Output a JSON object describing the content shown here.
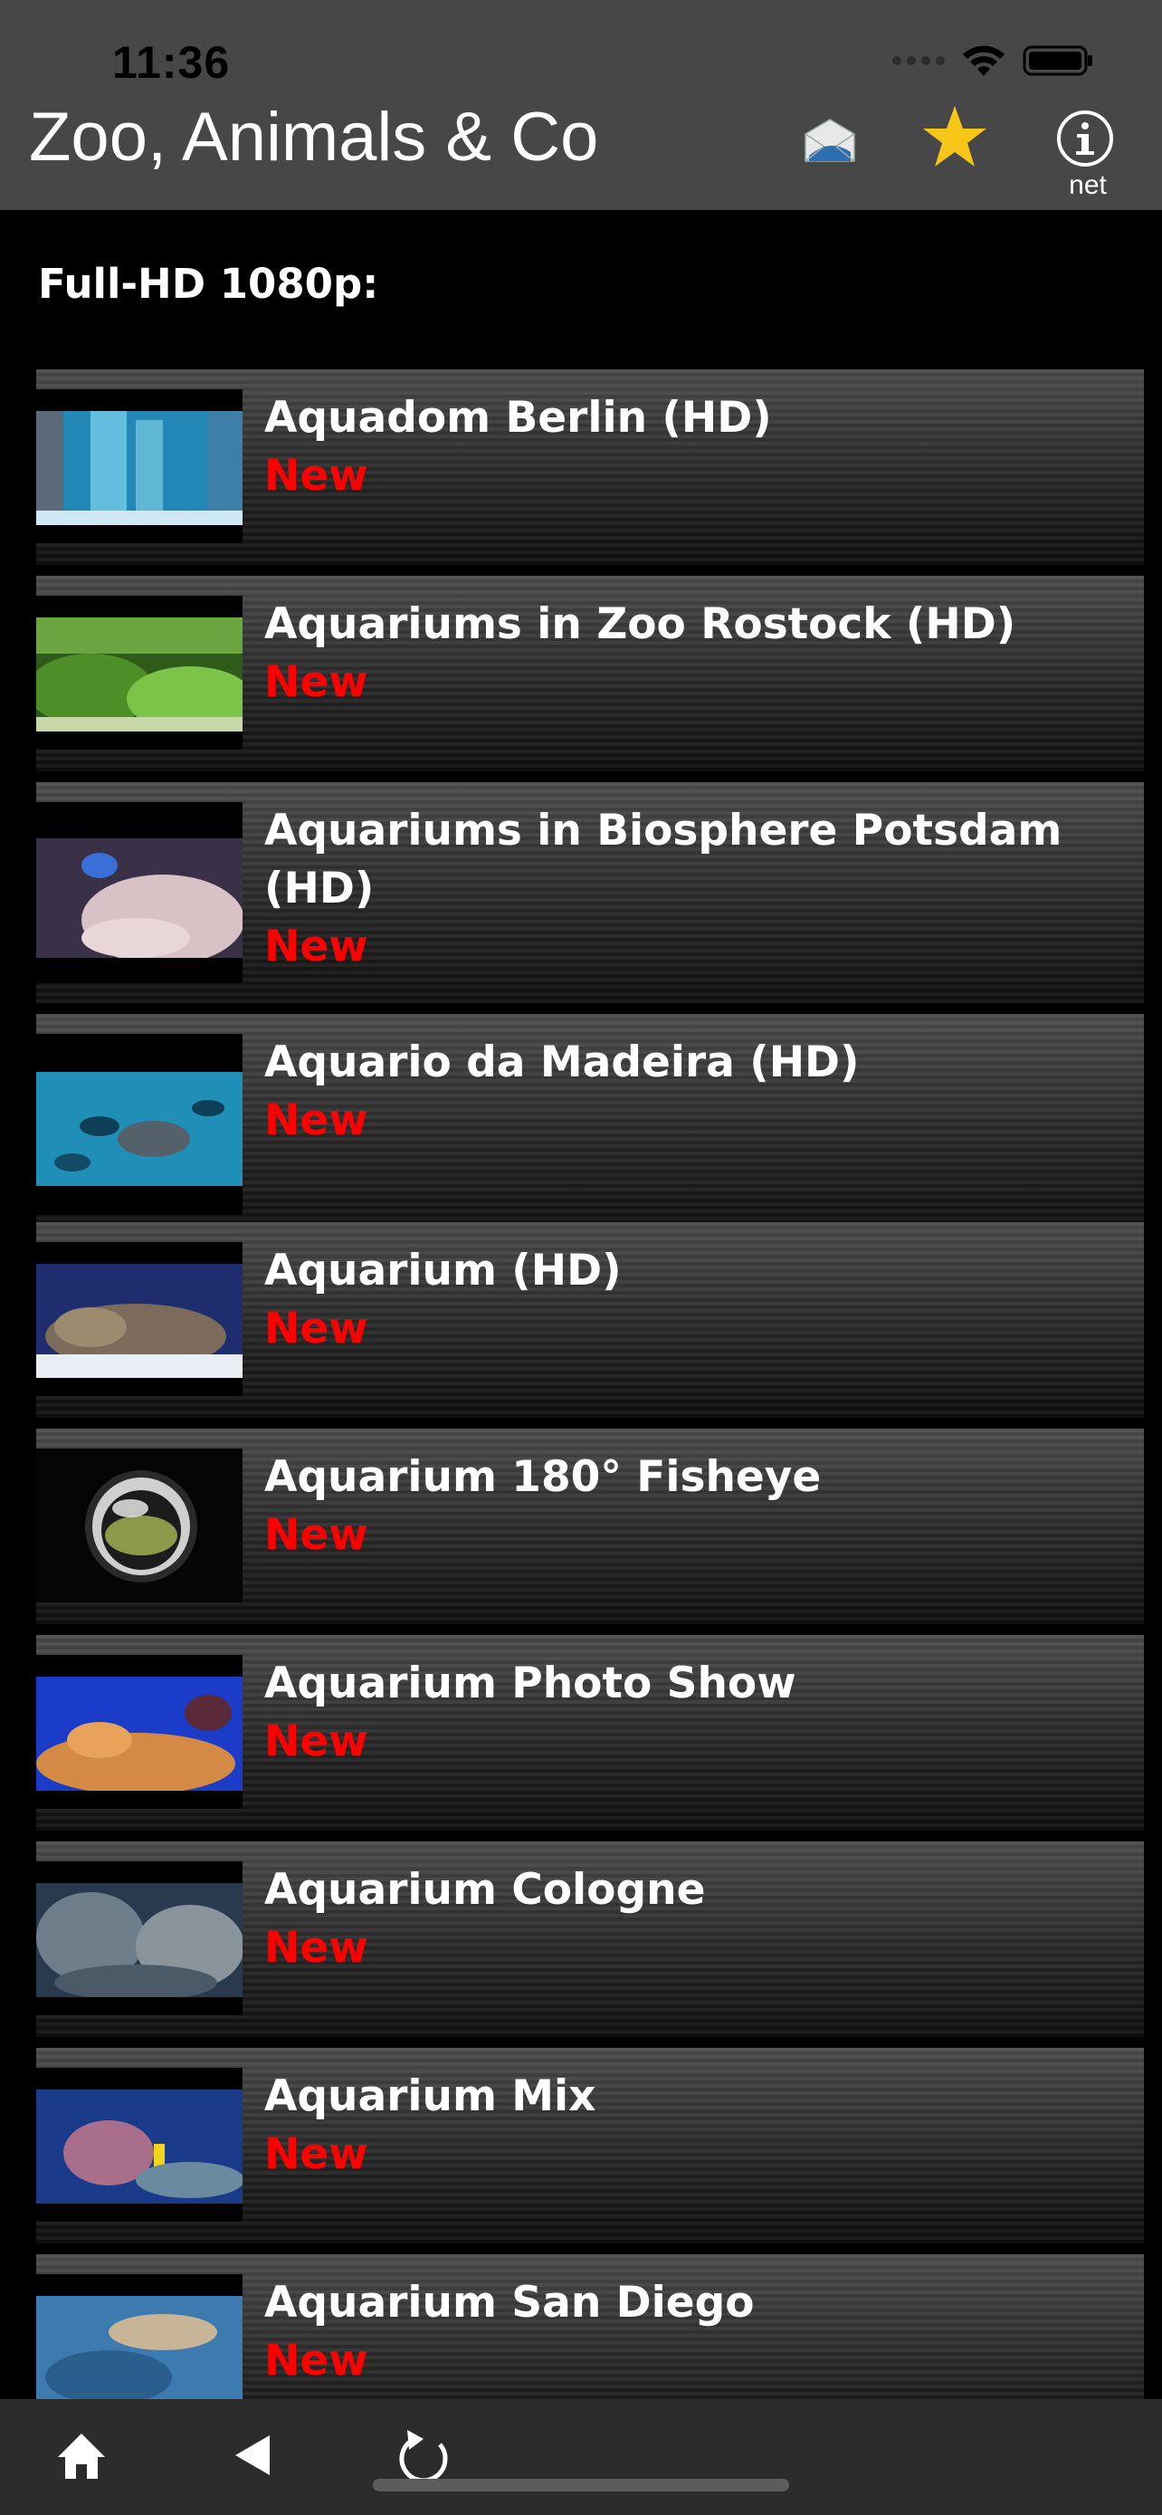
{
  "status_bar": {
    "time": "11:36"
  },
  "header": {
    "title": "Zoo, Animals & Co",
    "info_label": "net",
    "icons": [
      "mail-icon",
      "star-icon",
      "info-icon"
    ],
    "colors": {
      "background": "#474747",
      "star": "#f5c518"
    }
  },
  "section": {
    "title": "Full-HD 1080p:"
  },
  "videos": [
    {
      "title": "Aquadom Berlin (HD)",
      "badge": "New"
    },
    {
      "title": "Aquariums in Zoo Rostock (HD)",
      "badge": "New"
    },
    {
      "title": "Aquariums in Biosphere Potsdam (HD)",
      "badge": "New"
    },
    {
      "title": "Aquario da Madeira (HD)",
      "badge": "New"
    },
    {
      "title": "Aquarium (HD)",
      "badge": "New"
    },
    {
      "title": "Aquarium 180° Fisheye",
      "badge": "New"
    },
    {
      "title": "Aquarium Photo Show",
      "badge": "New"
    },
    {
      "title": "Aquarium Cologne",
      "badge": "New"
    },
    {
      "title": "Aquarium Mix",
      "badge": "New"
    },
    {
      "title": "Aquarium San Diego",
      "badge": "New"
    }
  ],
  "toolbar": {
    "icons": [
      "home-icon",
      "back-icon",
      "reload-icon"
    ]
  },
  "colors": {
    "badge": "#ff0000",
    "toolbar": "#2c2c2c"
  }
}
